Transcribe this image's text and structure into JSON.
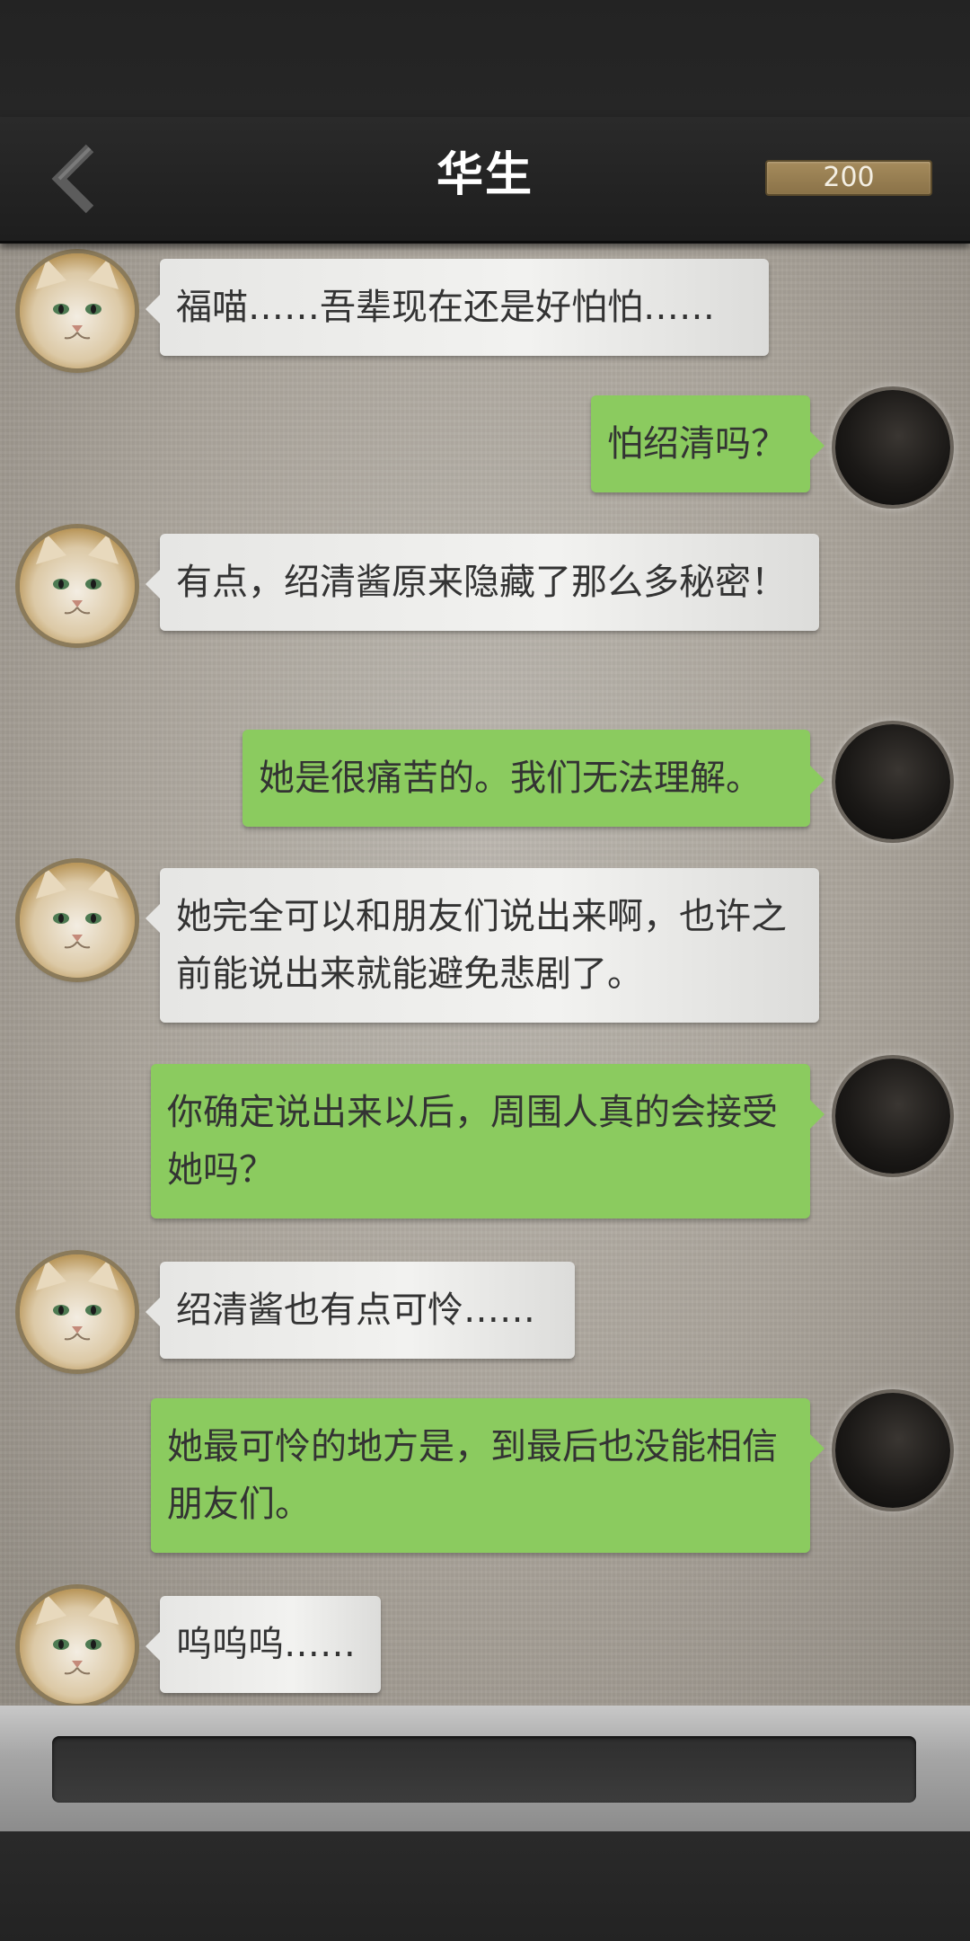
{
  "header": {
    "title": "华生",
    "coins": "200",
    "back_icon": "chevron-left-icon"
  },
  "messages": [
    {
      "side": "in",
      "text": "福喵……吾辈现在还是好怕怕……"
    },
    {
      "side": "out",
      "text": "怕绍清吗？"
    },
    {
      "side": "in",
      "text": "有点，绍清酱原来隐藏了那么多秘密！"
    },
    {
      "side": "out",
      "text": "她是很痛苦的。我们无法理解。"
    },
    {
      "side": "in",
      "text": "她完全可以和朋友们说出来啊，也许之前能说出来就能避免悲剧了。"
    },
    {
      "side": "out",
      "text": "你确定说出来以后，周围人真的会接受她吗？"
    },
    {
      "side": "in",
      "text": "绍清酱也有点可怜……"
    },
    {
      "side": "out",
      "text": "她最可怜的地方是，到最后也没能相信朋友们。"
    },
    {
      "side": "in",
      "text": "呜呜呜……"
    }
  ],
  "input": {
    "placeholder": ""
  },
  "colors": {
    "bubble_out": "#8bcb5f",
    "bubble_in": "#eeeeec",
    "coin_badge": "#9b8254"
  }
}
